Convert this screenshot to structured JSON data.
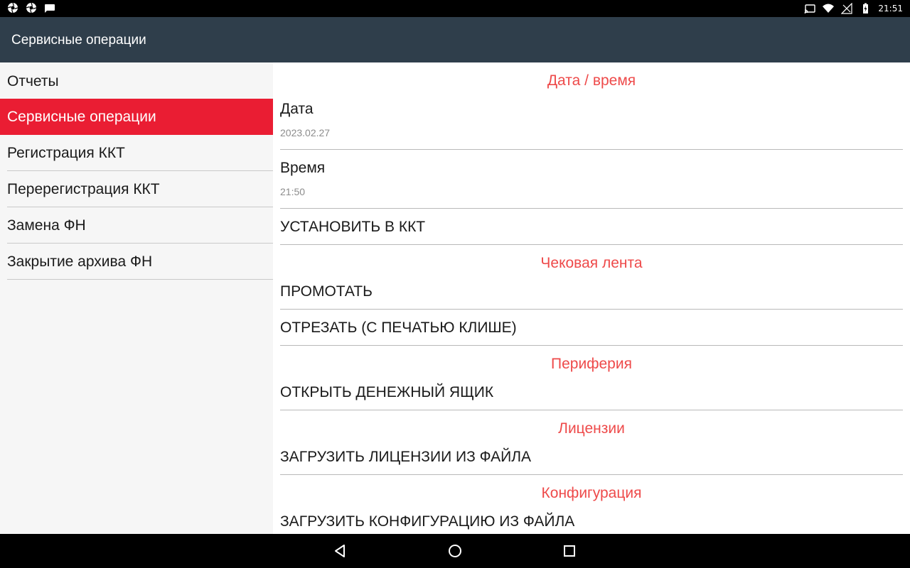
{
  "status_bar": {
    "time": "21:51",
    "left_icons": [
      "aperture-icon",
      "aperture-icon",
      "chat-bubble-icon"
    ],
    "right_icons": [
      "cast-icon",
      "wifi-icon",
      "signal-off-icon",
      "battery-charging-icon"
    ]
  },
  "app_bar": {
    "title": "Сервисные операции"
  },
  "sidebar": {
    "items": [
      {
        "label": "Отчеты",
        "selected": false
      },
      {
        "label": "Сервисные операции",
        "selected": true
      },
      {
        "label": "Регистрация ККТ",
        "selected": false
      },
      {
        "label": "Перерегистрация ККТ",
        "selected": false
      },
      {
        "label": "Замена ФН",
        "selected": false
      },
      {
        "label": "Закрытие архива ФН",
        "selected": false
      }
    ]
  },
  "main": {
    "date_time": {
      "header": "Дата / время",
      "date_title": "Дата",
      "date_value": "2023.02.27",
      "time_title": "Время",
      "time_value": "21:50",
      "set_button": "УСТАНОВИТЬ В ККТ"
    },
    "receipt_tape": {
      "header": "Чековая лента",
      "scroll_button": "ПРОМОТАТЬ",
      "cut_button": "ОТРЕЗАТЬ (С ПЕЧАТЬЮ КЛИШЕ)"
    },
    "peripherals": {
      "header": "Периферия",
      "open_drawer_button": "ОТКРЫТЬ ДЕНЕЖНЫЙ ЯЩИК"
    },
    "licenses": {
      "header": "Лицензии",
      "load_button": "ЗАГРУЗИТЬ ЛИЦЕНЗИИ ИЗ ФАЙЛА"
    },
    "configuration": {
      "header": "Конфигурация",
      "load_button": "ЗАГРУЗИТЬ КОНФИГУРАЦИЮ ИЗ ФАЙЛА"
    }
  },
  "colors": {
    "accent_red": "#ea1d33",
    "section_header": "#ee4a4a",
    "app_bar": "#2f3e4b"
  }
}
